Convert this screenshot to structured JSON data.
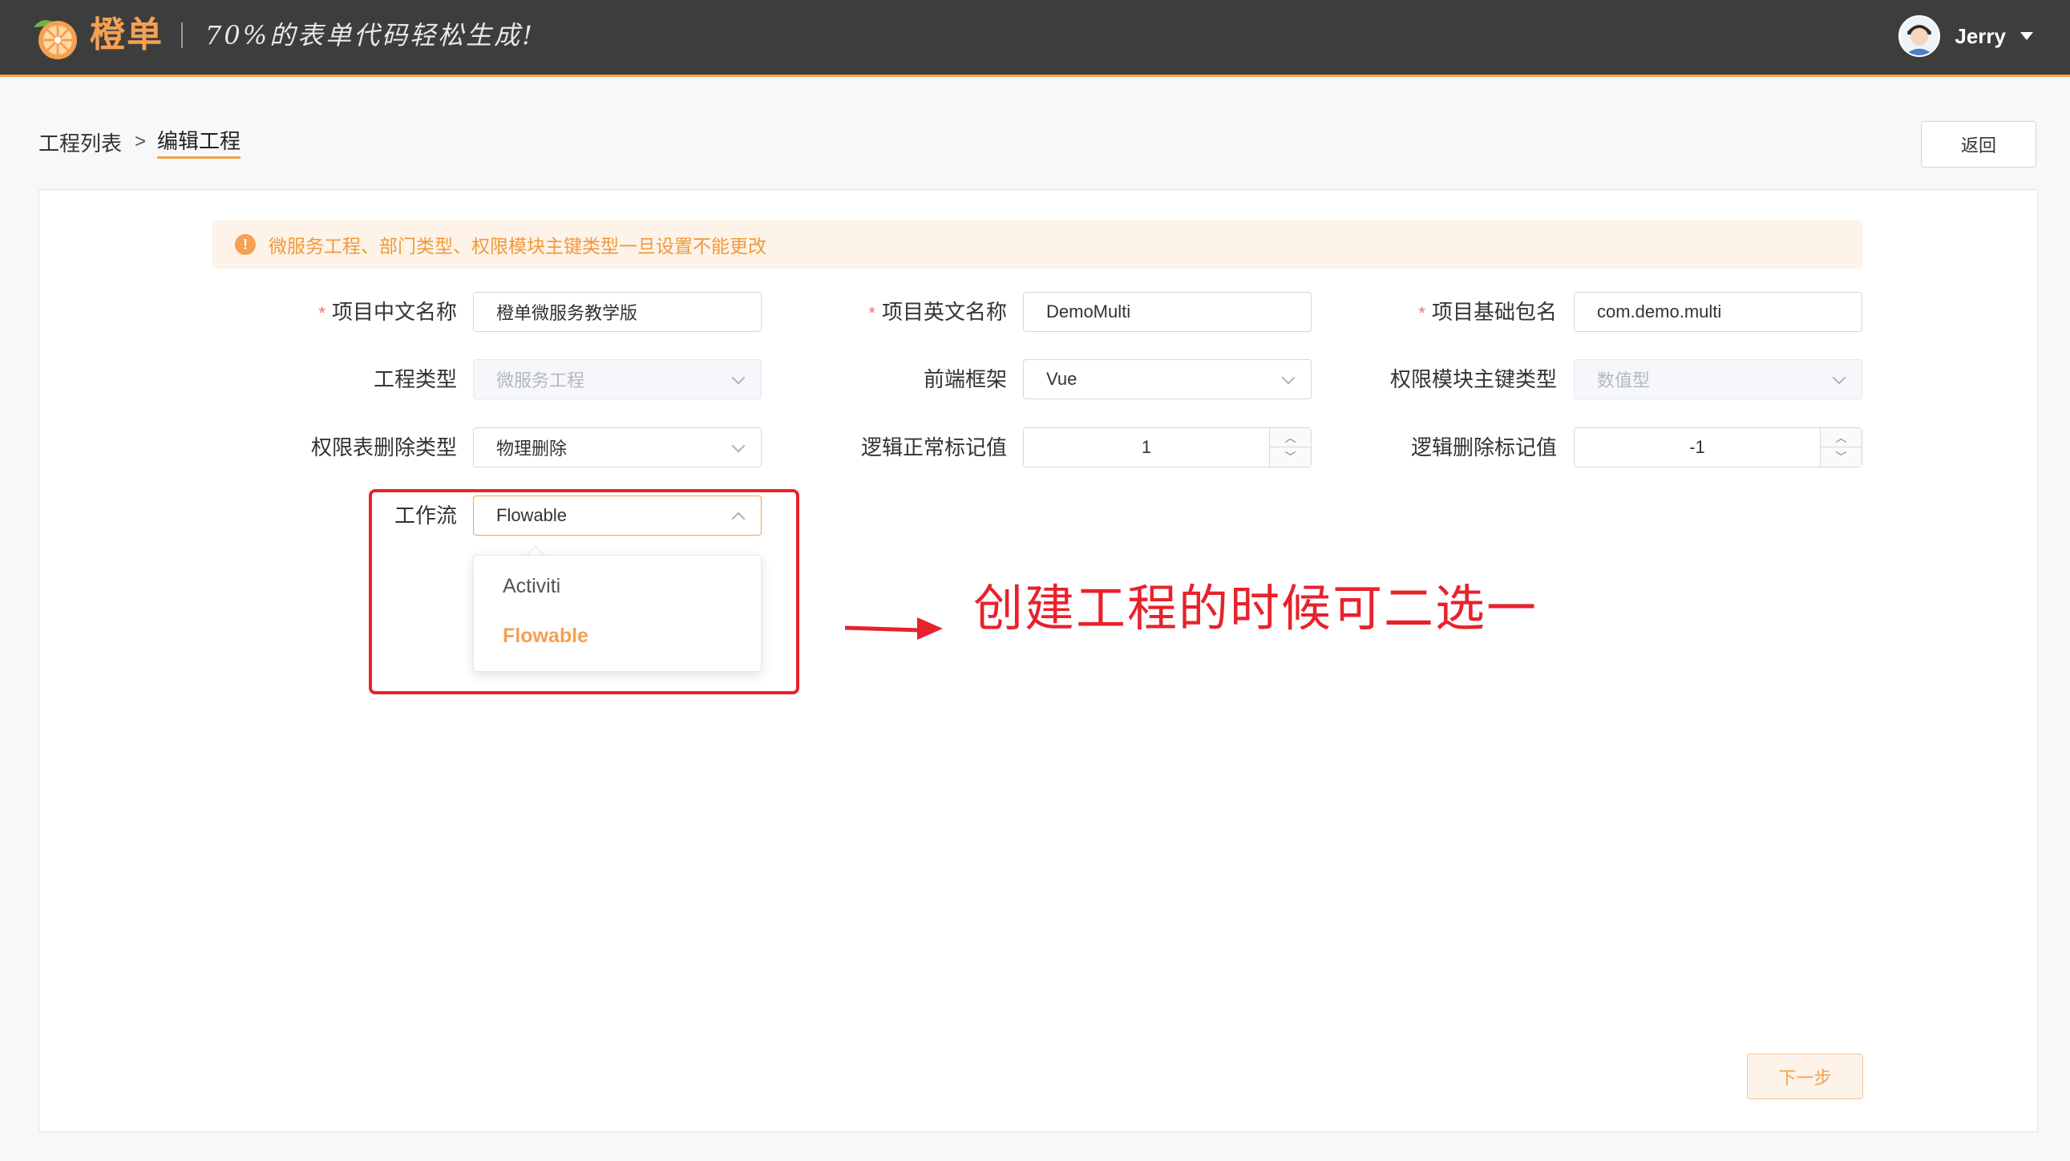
{
  "header": {
    "logo_text": "橙单",
    "slogan": "70%的表单代码轻松生成!",
    "user_name": "Jerry"
  },
  "breadcrumb": {
    "parent": "工程列表",
    "separator": ">",
    "current": "编辑工程"
  },
  "back_button": "返回",
  "alert": {
    "text": "微服务工程、部门类型、权限模块主键类型一旦设置不能更改"
  },
  "form": {
    "project_cn_name": {
      "label": "项目中文名称",
      "required": true,
      "value": "橙单微服务教学版"
    },
    "project_en_name": {
      "label": "项目英文名称",
      "required": true,
      "value": "DemoMulti"
    },
    "base_package": {
      "label": "项目基础包名",
      "required": true,
      "value": "com.demo.multi"
    },
    "project_type": {
      "label": "工程类型",
      "value": "微服务工程",
      "disabled": true
    },
    "frontend_framework": {
      "label": "前端框架",
      "value": "Vue"
    },
    "permission_pk_type": {
      "label": "权限模块主键类型",
      "value": "数值型",
      "disabled": true
    },
    "delete_type": {
      "label": "权限表删除类型",
      "value": "物理删除"
    },
    "logic_normal_value": {
      "label": "逻辑正常标记值",
      "value": "1"
    },
    "logic_delete_value": {
      "label": "逻辑删除标记值",
      "value": "-1"
    },
    "workflow": {
      "label": "工作流",
      "value": "Flowable",
      "options": [
        "Activiti",
        "Flowable"
      ],
      "selected_index": 1
    },
    "required_mark": "*"
  },
  "annotation": {
    "text": "创建工程的时候可二选一",
    "color": "#e8222c"
  },
  "next_button": "下一步",
  "colors": {
    "accent": "#f5a052",
    "header_bg": "#3d3d3d",
    "annotation_red": "#e8222c"
  }
}
